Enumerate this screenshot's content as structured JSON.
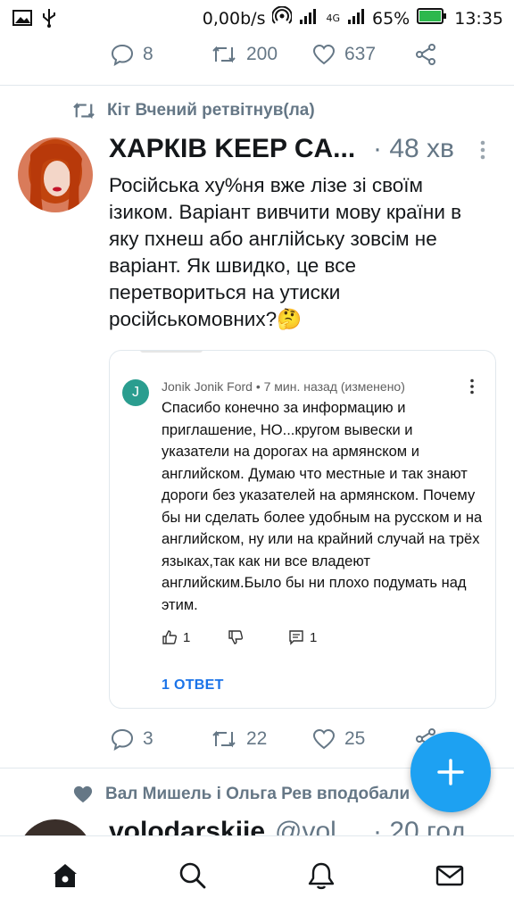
{
  "status_bar": {
    "speed": "0,00b/s",
    "network": "4G",
    "battery": "65%",
    "time": "13:35"
  },
  "top_tweet_actions": {
    "replies": "8",
    "retweets": "200",
    "likes": "637"
  },
  "retweet_context": {
    "text": "Кіт Вчений ретвітнув(ла)"
  },
  "tweet": {
    "author": "ХАРКІВ KEEP CA...",
    "time": "· 48 хв",
    "text": "Російська ху%ня вже лізе зі своїм ізиком. Варіант вивчити мову країни в яку пхнеш або англійську зовсім не варіант. Як швидко, це все перетвориться на утиски російськомовних?🤔",
    "actions": {
      "replies": "3",
      "retweets": "22",
      "likes": "25"
    }
  },
  "embedded_comment": {
    "avatar_letter": "J",
    "meta": "Jonik Jonik Ford • 7 мин. назад (изменено)",
    "text": "Спасибо конечно за информацию и приглашение, НО...кругом вывески и указатели на дорогах на армянском и английском. Думаю что местные и так знают дороги без указателей на армянском. Почему бы ни сделать более удобным на русском и на английском, ну или на крайний случай на трёх языках,так как ни все владеют английским.Было бы ни плохо подумать над этим.",
    "likes": "1",
    "comments": "1",
    "reply_link": "1 ОТВЕТ"
  },
  "like_context": {
    "text": "Вал Мишель і Ольга Рев вподобали"
  },
  "next_tweet": {
    "author": "volodarskiie",
    "handle": "@vol...",
    "time": "· 20 год"
  },
  "colors": {
    "accent": "#1da1f2",
    "secondary_text": "#657786",
    "link": "#1a73e8"
  }
}
